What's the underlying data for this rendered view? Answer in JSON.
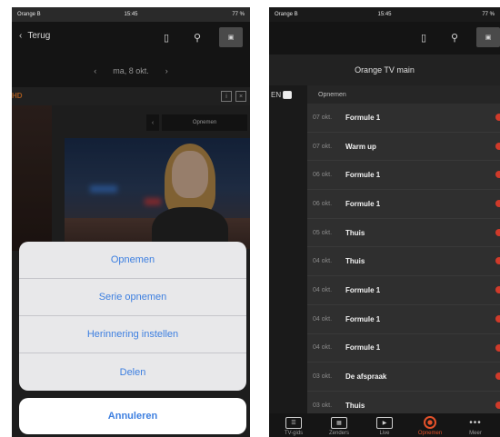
{
  "left": {
    "status": {
      "carrier": "Orange B",
      "time": "15:45",
      "battery": "77 %"
    },
    "nav": {
      "back_label": "Terug"
    },
    "date_label": "ma, 8 okt.",
    "channel_logo": "HD",
    "record_button": "Opnemen",
    "action_sheet": {
      "items": [
        "Opnemen",
        "Serie opnemen",
        "Herinnering instellen",
        "Delen"
      ],
      "cancel": "Annuleren"
    }
  },
  "right": {
    "status": {
      "carrier": "Orange B",
      "time": "15:45",
      "battery": "77 %"
    },
    "title": "Orange TV main",
    "channel_short": "EN",
    "list_header": "Opnemen",
    "rows": [
      {
        "date": "07 okt.",
        "title": "Formule 1"
      },
      {
        "date": "07 okt.",
        "title": "Warm up"
      },
      {
        "date": "06 okt.",
        "title": "Formule 1"
      },
      {
        "date": "06 okt.",
        "title": "Formule 1"
      },
      {
        "date": "05 okt.",
        "title": "Thuis"
      },
      {
        "date": "04 okt.",
        "title": "Thuis"
      },
      {
        "date": "04 okt.",
        "title": "Formule 1"
      },
      {
        "date": "04 okt.",
        "title": "Formule 1"
      },
      {
        "date": "04 okt.",
        "title": "Formule 1"
      },
      {
        "date": "03 okt.",
        "title": "De afspraak"
      },
      {
        "date": "03 okt.",
        "title": "Thuis"
      }
    ],
    "tabs": [
      "TV-gids",
      "Zenders",
      "Live",
      "Opnemen",
      "Meer"
    ],
    "active_tab": "Opnemen"
  },
  "colors": {
    "accent": "#e4512a",
    "link_blue": "#3d7fe0"
  }
}
